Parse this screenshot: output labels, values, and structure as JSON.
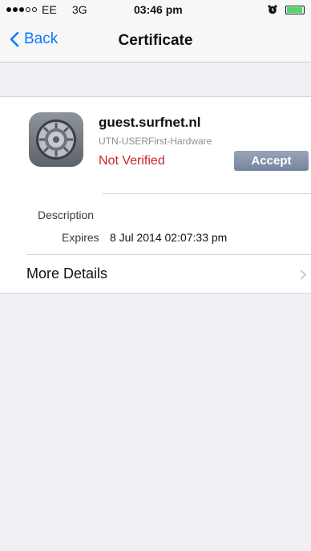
{
  "status_bar": {
    "carrier": "EE",
    "network": "3G",
    "time": "03:46 pm",
    "signal_dots_filled": 3,
    "signal_dots_total": 5,
    "battery_level": 0.95,
    "battery_color": "#4cd964"
  },
  "nav": {
    "back_label": "Back",
    "title": "Certificate",
    "accent_color": "#0a7aff"
  },
  "certificate": {
    "name": "guest.surfnet.nl",
    "issuer": "UTN-USERFirst-Hardware",
    "status": "Not Verified",
    "status_color": "#c9252c",
    "accept_label": "Accept",
    "icon": "settings-gear-icon"
  },
  "details": {
    "description_label": "Description",
    "expires_label": "Expires",
    "expires_value": "8 Jul 2014 02:07:33 pm",
    "more_details_label": "More Details"
  }
}
